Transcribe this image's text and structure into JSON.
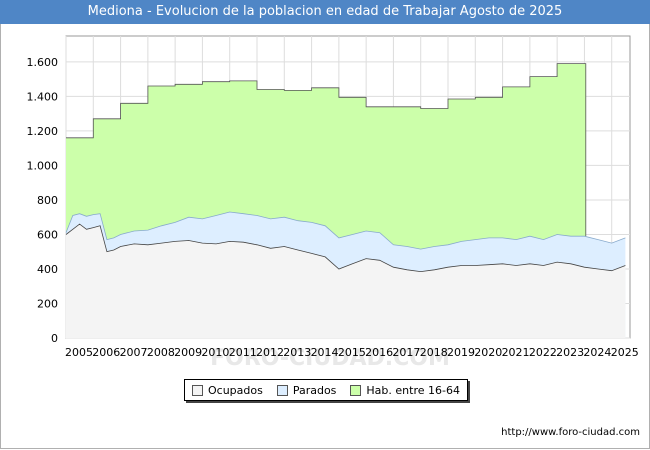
{
  "chart_data": {
    "type": "area",
    "title": "Mediona - Evolucion de la poblacion en edad de Trabajar Agosto de 2025",
    "xlabel": "",
    "ylabel": "",
    "ylim": [
      0,
      1750
    ],
    "xlim": [
      2005,
      2025.67
    ],
    "yticks": [
      0,
      200,
      400,
      600,
      800,
      1000,
      1200,
      1400,
      1600
    ],
    "ytick_labels": [
      "0",
      "200",
      "400",
      "600",
      "800",
      "1.000",
      "1.200",
      "1.400",
      "1.600"
    ],
    "xticks": [
      2005,
      2006,
      2007,
      2008,
      2009,
      2010,
      2011,
      2012,
      2013,
      2014,
      2015,
      2016,
      2017,
      2018,
      2019,
      2020,
      2021,
      2022,
      2023,
      2024,
      2025
    ],
    "grid": true,
    "legend_placement": "bottom",
    "series": [
      {
        "name": "Hab. entre 16-64",
        "color": "#ccffaa",
        "step": true,
        "x": [
          2005,
          2006,
          2007,
          2008,
          2009,
          2010,
          2011,
          2012,
          2013,
          2014,
          2015,
          2016,
          2017,
          2018,
          2019,
          2020,
          2021,
          2022,
          2023,
          2024
        ],
        "values": [
          1160,
          1270,
          1360,
          1460,
          1470,
          1485,
          1490,
          1440,
          1435,
          1450,
          1395,
          1340,
          1340,
          1330,
          1385,
          1395,
          1455,
          1515,
          1590,
          1590
        ]
      },
      {
        "name": "Parados",
        "color": "#ddeeff",
        "x": [
          2005,
          2005.25,
          2005.5,
          2005.75,
          2006,
          2006.25,
          2006.5,
          2006.75,
          2007,
          2007.5,
          2008,
          2008.5,
          2009,
          2009.5,
          2010,
          2010.5,
          2011,
          2011.5,
          2012,
          2012.5,
          2013,
          2013.5,
          2014,
          2014.5,
          2015,
          2015.5,
          2016,
          2016.5,
          2017,
          2017.5,
          2018,
          2018.5,
          2019,
          2019.5,
          2020,
          2020.5,
          2021,
          2021.5,
          2022,
          2022.5,
          2023,
          2023.5,
          2024,
          2024.5,
          2025,
          2025.5
        ],
        "values": [
          610,
          710,
          720,
          705,
          715,
          720,
          570,
          580,
          600,
          620,
          625,
          650,
          670,
          700,
          690,
          710,
          730,
          720,
          710,
          690,
          700,
          680,
          670,
          650,
          580,
          600,
          620,
          610,
          540,
          530,
          515,
          530,
          540,
          560,
          570,
          580,
          580,
          570,
          590,
          570,
          600,
          590,
          590,
          570,
          550,
          580
        ]
      },
      {
        "name": "Ocupados",
        "color": "#f4f4f4",
        "x": [
          2005,
          2005.25,
          2005.5,
          2005.75,
          2006,
          2006.25,
          2006.5,
          2006.75,
          2007,
          2007.5,
          2008,
          2008.5,
          2009,
          2009.5,
          2010,
          2010.5,
          2011,
          2011.5,
          2012,
          2012.5,
          2013,
          2013.5,
          2014,
          2014.5,
          2015,
          2015.5,
          2016,
          2016.5,
          2017,
          2017.5,
          2018,
          2018.5,
          2019,
          2019.5,
          2020,
          2020.5,
          2021,
          2021.5,
          2022,
          2022.5,
          2023,
          2023.5,
          2024,
          2024.5,
          2025,
          2025.5
        ],
        "values": [
          600,
          630,
          660,
          630,
          640,
          650,
          500,
          510,
          530,
          545,
          540,
          550,
          560,
          565,
          550,
          545,
          560,
          555,
          540,
          520,
          530,
          510,
          490,
          470,
          400,
          430,
          460,
          450,
          410,
          395,
          385,
          395,
          410,
          420,
          420,
          425,
          430,
          420,
          430,
          420,
          440,
          430,
          410,
          400,
          390,
          420
        ]
      }
    ]
  },
  "legend": {
    "items": [
      {
        "label": "Ocupados",
        "color": "#f4f4f4"
      },
      {
        "label": "Parados",
        "color": "#ddeeff"
      },
      {
        "label": "Hab. entre 16-64",
        "color": "#ccffaa"
      }
    ]
  },
  "source": "http://www.foro-ciudad.com",
  "watermark": "FORO-CIUDAD.COM"
}
